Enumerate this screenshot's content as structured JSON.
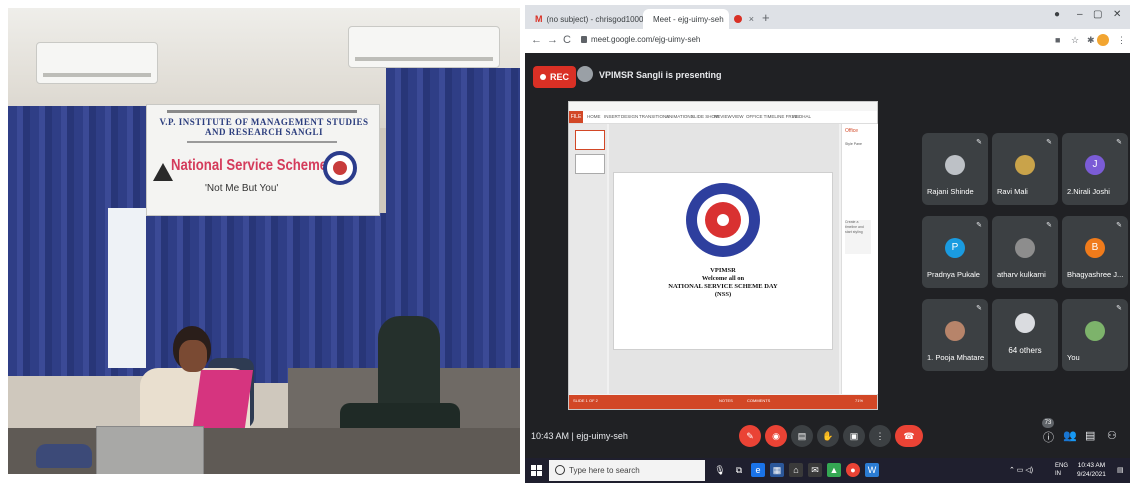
{
  "photo": {
    "banner_institute": "V.P. INSTITUTE OF MANAGEMENT STUDIES AND RESEARCH SANGLI",
    "banner_title": "National Service Scheme",
    "banner_motto": "'Not Me But You'"
  },
  "browser": {
    "tabs": [
      {
        "label": "(no subject) - chrisgod1000@gm",
        "icon": "gmail-icon"
      },
      {
        "label": "Meet - ejg-uimy-seh",
        "icon": "meet-icon"
      },
      {
        "label": "",
        "icon": "recording-dot-icon"
      }
    ],
    "new_tab": "+",
    "url": "meet.google.com/ejg-uimy-seh"
  },
  "meet": {
    "rec_label": "REC",
    "presenting": "VPIMSR Sangli is presenting",
    "meeting_time": "10:43 AM",
    "separator": "|",
    "meeting_code": "ejg-uimy-seh",
    "people_count": "73",
    "participants": [
      {
        "name": "Rajani Shinde",
        "initial": "",
        "color": "#bdc1c6"
      },
      {
        "name": "Ravi Mali",
        "initial": "",
        "color": "#c9a34a"
      },
      {
        "name": "2.Nirali Joshi",
        "initial": "J",
        "color": "#7b5cd6"
      },
      {
        "name": "Pradnya Pukale",
        "initial": "P",
        "color": "#1a9be0"
      },
      {
        "name": "atharv kulkarni",
        "initial": "",
        "color": "#8d8d8d"
      },
      {
        "name": "Bhagyashree J...",
        "initial": "B",
        "color": "#f07b1b"
      },
      {
        "name": "1. Pooja Mhatare",
        "initial": "",
        "color": "#b7846a"
      },
      {
        "name": "64 others",
        "initial": "",
        "color": "#dadce0"
      },
      {
        "name": "You",
        "initial": "",
        "color": "#7db36b"
      }
    ]
  },
  "slide": {
    "line1": "VPIMSR",
    "line2": "Welcome all on",
    "line3": "NATIONAL SERVICE SCHEME DAY",
    "line4": "(NSS)"
  },
  "ppt": {
    "file_tab": "FILE",
    "menu": [
      "HOME",
      "INSERT",
      "DESIGN",
      "TRANSITIONS",
      "ANIMATIONS",
      "SLIDE SHOW",
      "REVIEW",
      "VIEW",
      "OFFICE TIMELINE FREE",
      "ABDHAL"
    ],
    "side_title": "Office",
    "side_subtitle": "Style Pane",
    "side_box": "Create a timeline and start styling",
    "status": "SLIDE 1 OF 2",
    "status2": "NOTES",
    "status3": "COMMENTS",
    "zoom": "71%"
  },
  "taskbar": {
    "search_placeholder": "Type here to search",
    "lang": "ENG",
    "region": "IN",
    "time": "10:43 AM",
    "date": "9/24/2021"
  }
}
